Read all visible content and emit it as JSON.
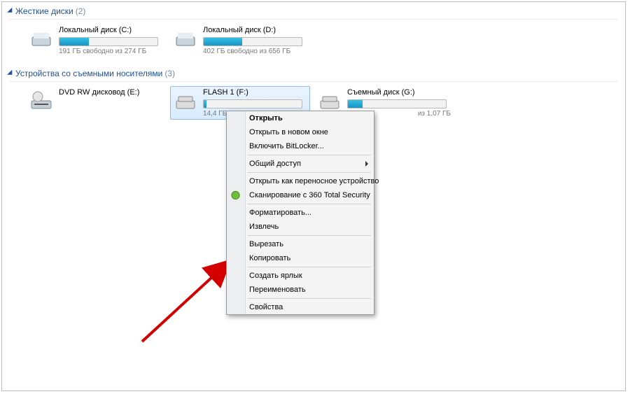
{
  "groups": {
    "hdd": {
      "title": "Жесткие диски",
      "count": "(2)"
    },
    "removable": {
      "title": "Устройства со съемными носителями",
      "count": "(3)"
    }
  },
  "drives": {
    "c": {
      "name": "Локальный диск (C:)",
      "status": "191 ГБ свободно из 274 ГБ"
    },
    "d": {
      "name": "Локальный диск (D:)",
      "status": "402 ГБ свободно из 656 ГБ"
    },
    "dvd": {
      "name": "DVD RW дисковод (E:)"
    },
    "f": {
      "name": "FLASH 1 (F:)",
      "status": "14,4 ГБ сво"
    },
    "g": {
      "name": "Съемный диск (G:)",
      "status": "из 1,07 ГБ"
    }
  },
  "menu": {
    "open": "Открыть",
    "open_new": "Открыть в новом окне",
    "bitlocker": "Включить BitLocker...",
    "share": "Общий доступ",
    "portable": "Открыть как переносное устройство",
    "scan360": "Сканирование с 360 Total Security",
    "format": "Форматировать...",
    "eject": "Извлечь",
    "cut": "Вырезать",
    "copy": "Копировать",
    "shortcut": "Создать ярлык",
    "rename": "Переименовать",
    "properties": "Свойства"
  }
}
